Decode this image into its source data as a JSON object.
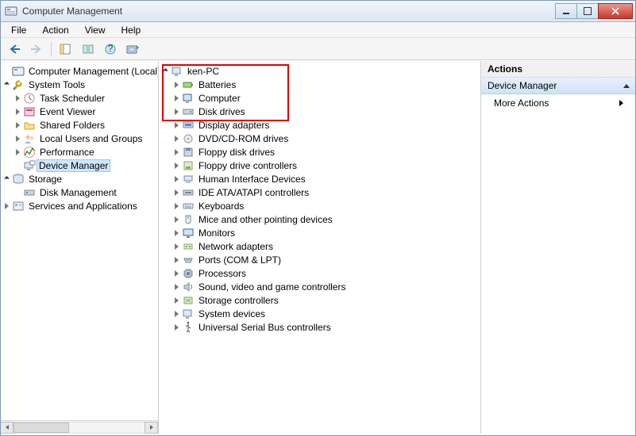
{
  "window": {
    "title": "Computer Management"
  },
  "menu": {
    "file": "File",
    "action": "Action",
    "view": "View",
    "help": "Help"
  },
  "toolbar": {
    "back_icon": "back-arrow",
    "forward_icon": "forward-arrow",
    "show_icon": "show-hide",
    "properties_icon": "properties",
    "help_icon": "help",
    "scan_icon": "scan-hardware"
  },
  "left_tree": {
    "root": "Computer Management (Local)",
    "system_tools": "System Tools",
    "task_scheduler": "Task Scheduler",
    "event_viewer": "Event Viewer",
    "shared_folders": "Shared Folders",
    "local_users": "Local Users and Groups",
    "performance": "Performance",
    "device_manager": "Device Manager",
    "storage": "Storage",
    "disk_management": "Disk Management",
    "services_apps": "Services and Applications"
  },
  "center_tree": {
    "root": "ken-PC",
    "batteries": "Batteries",
    "computer": "Computer",
    "disk_drives": "Disk drives",
    "display_adapters": "Display adapters",
    "dvd": "DVD/CD-ROM drives",
    "floppy_drives": "Floppy disk drives",
    "floppy_ctrl": "Floppy drive controllers",
    "hid": "Human Interface Devices",
    "ide": "IDE ATA/ATAPI controllers",
    "keyboards": "Keyboards",
    "mice": "Mice and other pointing devices",
    "monitors": "Monitors",
    "network": "Network adapters",
    "ports": "Ports (COM & LPT)",
    "processors": "Processors",
    "sound": "Sound, video and game controllers",
    "storage_ctrl": "Storage controllers",
    "system_devices": "System devices",
    "usb": "Universal Serial Bus controllers"
  },
  "right": {
    "header": "Actions",
    "section": "Device Manager",
    "more_actions": "More Actions"
  }
}
